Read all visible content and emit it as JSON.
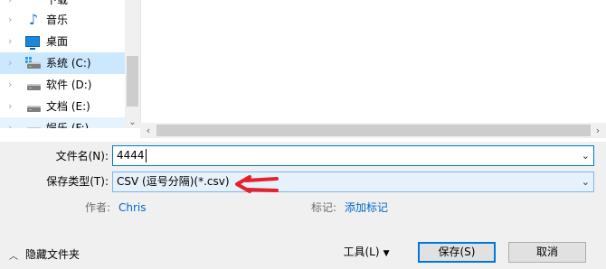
{
  "nav_tree": {
    "items": [
      {
        "label": "下载",
        "icon": "download-folder-icon",
        "state": "normal"
      },
      {
        "label": "音乐",
        "icon": "music-folder-icon",
        "state": "normal"
      },
      {
        "label": "桌面",
        "icon": "desktop-folder-icon",
        "state": "normal"
      },
      {
        "label": "系统 (C:)",
        "icon": "system-drive-icon",
        "state": "selected"
      },
      {
        "label": "软件 (D:)",
        "icon": "drive-icon",
        "state": "normal"
      },
      {
        "label": "文档 (E:)",
        "icon": "drive-icon",
        "state": "normal"
      },
      {
        "label": "娱乐 (F:)",
        "icon": "drive-icon",
        "state": "hovered"
      }
    ]
  },
  "form": {
    "filename_label": "文件名(N):",
    "filename_value": "4444",
    "filetype_label": "保存类型(T):",
    "filetype_value": "CSV (逗号分隔)(*.csv)"
  },
  "meta": {
    "author_label": "作者:",
    "author_value": "Chris",
    "tags_label": "标记:",
    "tags_value": "添加标记"
  },
  "footer": {
    "hide_folders_label": "隐藏文件夹",
    "tools_label": "工具(L)",
    "save_label": "保存(S)",
    "cancel_label": "取消"
  },
  "colors": {
    "accent": "#0078d7",
    "selection": "#cce8ff",
    "link": "#0066cc",
    "annotation_arrow": "#e8202a"
  }
}
